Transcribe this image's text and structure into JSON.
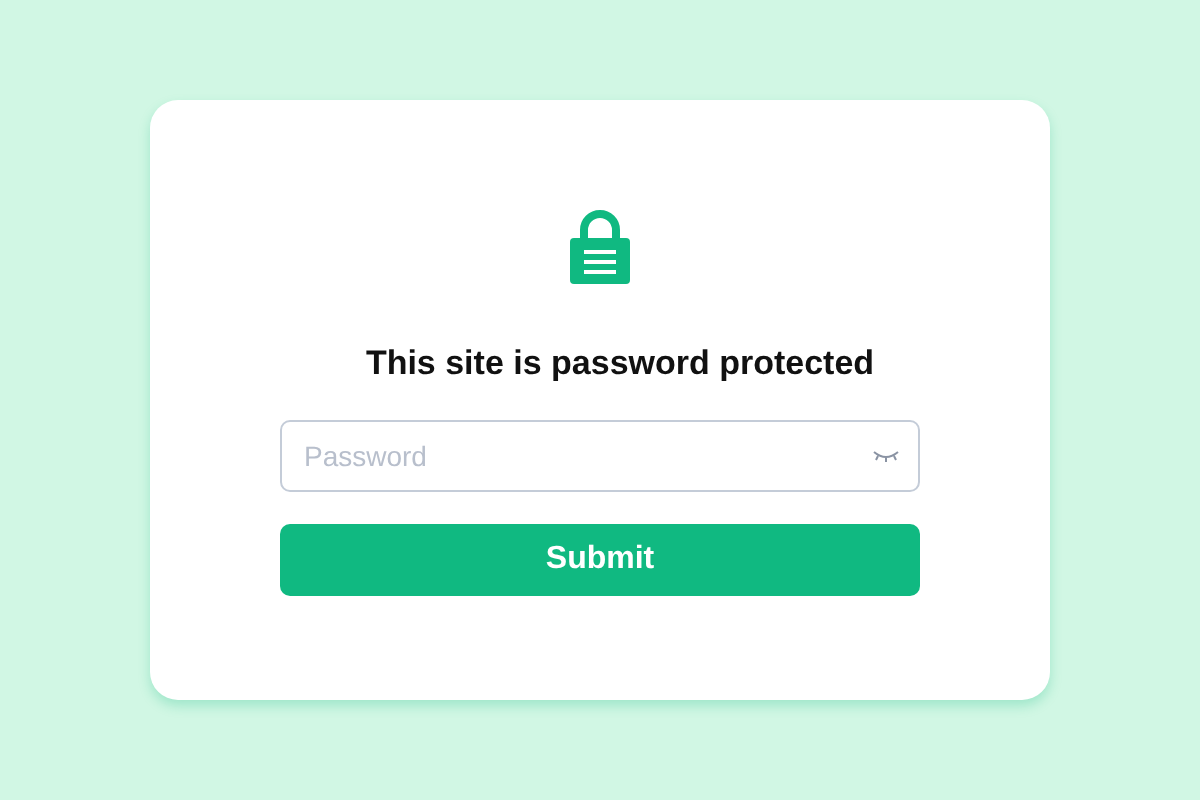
{
  "title": "This site is password protected",
  "password_field": {
    "placeholder": "Password"
  },
  "submit_button": {
    "label": "Submit"
  }
}
